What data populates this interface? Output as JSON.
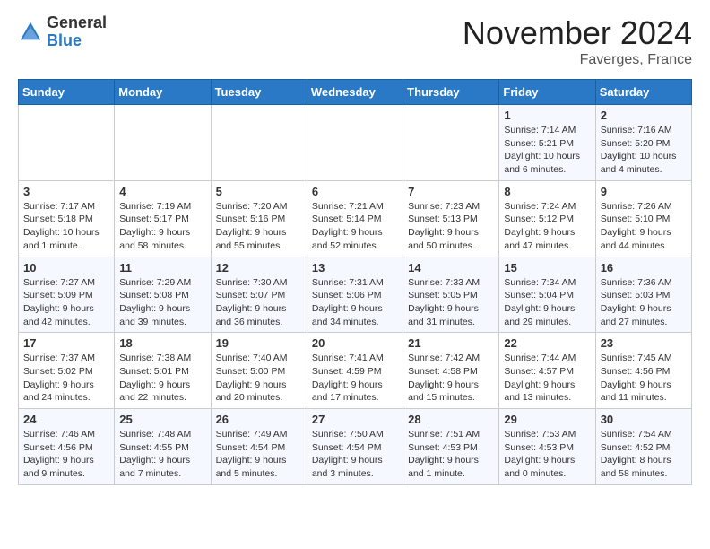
{
  "logo": {
    "general": "General",
    "blue": "Blue"
  },
  "header": {
    "month": "November 2024",
    "location": "Faverges, France"
  },
  "weekdays": [
    "Sunday",
    "Monday",
    "Tuesday",
    "Wednesday",
    "Thursday",
    "Friday",
    "Saturday"
  ],
  "weeks": [
    [
      {
        "day": "",
        "info": ""
      },
      {
        "day": "",
        "info": ""
      },
      {
        "day": "",
        "info": ""
      },
      {
        "day": "",
        "info": ""
      },
      {
        "day": "",
        "info": ""
      },
      {
        "day": "1",
        "info": "Sunrise: 7:14 AM\nSunset: 5:21 PM\nDaylight: 10 hours and 6 minutes."
      },
      {
        "day": "2",
        "info": "Sunrise: 7:16 AM\nSunset: 5:20 PM\nDaylight: 10 hours and 4 minutes."
      }
    ],
    [
      {
        "day": "3",
        "info": "Sunrise: 7:17 AM\nSunset: 5:18 PM\nDaylight: 10 hours and 1 minute."
      },
      {
        "day": "4",
        "info": "Sunrise: 7:19 AM\nSunset: 5:17 PM\nDaylight: 9 hours and 58 minutes."
      },
      {
        "day": "5",
        "info": "Sunrise: 7:20 AM\nSunset: 5:16 PM\nDaylight: 9 hours and 55 minutes."
      },
      {
        "day": "6",
        "info": "Sunrise: 7:21 AM\nSunset: 5:14 PM\nDaylight: 9 hours and 52 minutes."
      },
      {
        "day": "7",
        "info": "Sunrise: 7:23 AM\nSunset: 5:13 PM\nDaylight: 9 hours and 50 minutes."
      },
      {
        "day": "8",
        "info": "Sunrise: 7:24 AM\nSunset: 5:12 PM\nDaylight: 9 hours and 47 minutes."
      },
      {
        "day": "9",
        "info": "Sunrise: 7:26 AM\nSunset: 5:10 PM\nDaylight: 9 hours and 44 minutes."
      }
    ],
    [
      {
        "day": "10",
        "info": "Sunrise: 7:27 AM\nSunset: 5:09 PM\nDaylight: 9 hours and 42 minutes."
      },
      {
        "day": "11",
        "info": "Sunrise: 7:29 AM\nSunset: 5:08 PM\nDaylight: 9 hours and 39 minutes."
      },
      {
        "day": "12",
        "info": "Sunrise: 7:30 AM\nSunset: 5:07 PM\nDaylight: 9 hours and 36 minutes."
      },
      {
        "day": "13",
        "info": "Sunrise: 7:31 AM\nSunset: 5:06 PM\nDaylight: 9 hours and 34 minutes."
      },
      {
        "day": "14",
        "info": "Sunrise: 7:33 AM\nSunset: 5:05 PM\nDaylight: 9 hours and 31 minutes."
      },
      {
        "day": "15",
        "info": "Sunrise: 7:34 AM\nSunset: 5:04 PM\nDaylight: 9 hours and 29 minutes."
      },
      {
        "day": "16",
        "info": "Sunrise: 7:36 AM\nSunset: 5:03 PM\nDaylight: 9 hours and 27 minutes."
      }
    ],
    [
      {
        "day": "17",
        "info": "Sunrise: 7:37 AM\nSunset: 5:02 PM\nDaylight: 9 hours and 24 minutes."
      },
      {
        "day": "18",
        "info": "Sunrise: 7:38 AM\nSunset: 5:01 PM\nDaylight: 9 hours and 22 minutes."
      },
      {
        "day": "19",
        "info": "Sunrise: 7:40 AM\nSunset: 5:00 PM\nDaylight: 9 hours and 20 minutes."
      },
      {
        "day": "20",
        "info": "Sunrise: 7:41 AM\nSunset: 4:59 PM\nDaylight: 9 hours and 17 minutes."
      },
      {
        "day": "21",
        "info": "Sunrise: 7:42 AM\nSunset: 4:58 PM\nDaylight: 9 hours and 15 minutes."
      },
      {
        "day": "22",
        "info": "Sunrise: 7:44 AM\nSunset: 4:57 PM\nDaylight: 9 hours and 13 minutes."
      },
      {
        "day": "23",
        "info": "Sunrise: 7:45 AM\nSunset: 4:56 PM\nDaylight: 9 hours and 11 minutes."
      }
    ],
    [
      {
        "day": "24",
        "info": "Sunrise: 7:46 AM\nSunset: 4:56 PM\nDaylight: 9 hours and 9 minutes."
      },
      {
        "day": "25",
        "info": "Sunrise: 7:48 AM\nSunset: 4:55 PM\nDaylight: 9 hours and 7 minutes."
      },
      {
        "day": "26",
        "info": "Sunrise: 7:49 AM\nSunset: 4:54 PM\nDaylight: 9 hours and 5 minutes."
      },
      {
        "day": "27",
        "info": "Sunrise: 7:50 AM\nSunset: 4:54 PM\nDaylight: 9 hours and 3 minutes."
      },
      {
        "day": "28",
        "info": "Sunrise: 7:51 AM\nSunset: 4:53 PM\nDaylight: 9 hours and 1 minute."
      },
      {
        "day": "29",
        "info": "Sunrise: 7:53 AM\nSunset: 4:53 PM\nDaylight: 9 hours and 0 minutes."
      },
      {
        "day": "30",
        "info": "Sunrise: 7:54 AM\nSunset: 4:52 PM\nDaylight: 8 hours and 58 minutes."
      }
    ]
  ]
}
